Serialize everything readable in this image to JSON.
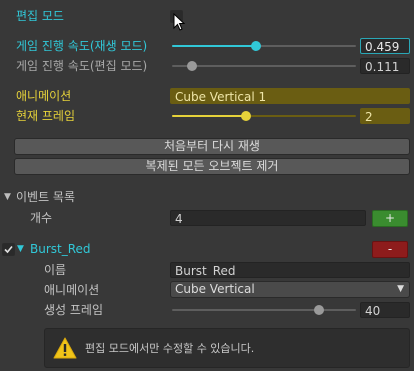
{
  "edit_mode": {
    "label": "편집 모드",
    "checked": false
  },
  "game_speed_play": {
    "label": "게임 진행 속도(재생 모드)",
    "value": "0.459",
    "level": 0.459
  },
  "game_speed_edit": {
    "label": "게임 진행 속도(편집 모드)",
    "value": "0.111",
    "level": 0.111
  },
  "animation": {
    "label": "애니메이션",
    "value": "Cube Vertical 1"
  },
  "current_frame": {
    "label": "현재 프레임",
    "value": "2",
    "level": 0.4
  },
  "buttons": {
    "replay": "처음부터 다시 재생",
    "remove_clones": "복제된 모든 오브젝트 제거"
  },
  "event_list": {
    "label": "이벤트 목록",
    "count_label": "개수",
    "count_value": "4",
    "add_label": "+"
  },
  "event": {
    "enabled": true,
    "title": "Burst_Red",
    "remove_label": "-",
    "name_label": "이름",
    "name_value": "Burst_Red",
    "anim_label": "애니메이션",
    "anim_value": "Cube Vertical",
    "frame_label": "생성 프레임",
    "frame_value": "40",
    "frame_level": 0.8
  },
  "warning": {
    "text": "편집 모드에서만 수정할 수 있습니다."
  },
  "colors": {
    "accent_cyan": "#31c8d8",
    "accent_yellow": "#e6d23a",
    "add_green": "#3a8c2f",
    "remove_red": "#8e1c1c"
  }
}
